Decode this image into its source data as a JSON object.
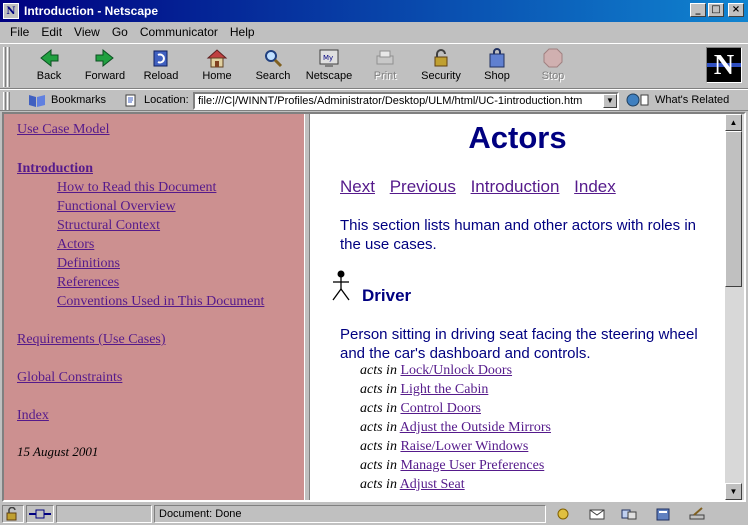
{
  "window": {
    "title": "Introduction - Netscape"
  },
  "menu": [
    "File",
    "Edit",
    "View",
    "Go",
    "Communicator",
    "Help"
  ],
  "toolbar": {
    "back": "Back",
    "forward": "Forward",
    "reload": "Reload",
    "home": "Home",
    "search": "Search",
    "netscape": "Netscape",
    "print": "Print",
    "security": "Security",
    "shop": "Shop",
    "stop": "Stop"
  },
  "location": {
    "bookmarks_label": "Bookmarks",
    "location_label": "Location:",
    "url": "file:///C|/WINNT/Profiles/Administrator/Desktop/ULM/html/UC-1introduction.htm",
    "related_label": "What's Related"
  },
  "nav": {
    "use_case_model": "Use Case Model",
    "introduction": "Introduction",
    "sub_items": [
      "How to Read this Document",
      "Functional Overview",
      "Structural Context",
      "Actors",
      "Definitions",
      "References",
      "Conventions Used in This Document"
    ],
    "requirements": "Requirements (Use Cases)",
    "global_constraints": "Global Constraints",
    "index": "Index",
    "date": "15 August 2001"
  },
  "page": {
    "heading": "Actors",
    "nav_links": [
      "Next",
      "Previous",
      "Introduction",
      "Index"
    ],
    "intro": "This section lists human and other actors with roles in the use cases.",
    "actor_name": "Driver",
    "actor_desc": "Person sitting in driving seat facing the steering wheel and the car's dashboard and controls.",
    "acts_prefix": "acts in",
    "acts_links": [
      "Lock/Unlock Doors",
      "Light the Cabin",
      "Control Doors",
      "Adjust the Outside Mirrors",
      "Raise/Lower Windows",
      "Manage User Preferences",
      "Adjust Seat"
    ]
  },
  "status": {
    "text": "Document: Done"
  }
}
